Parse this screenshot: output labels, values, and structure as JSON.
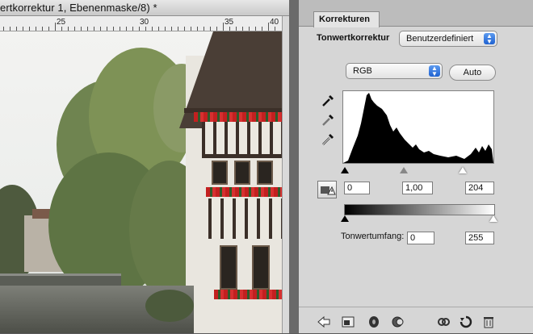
{
  "document": {
    "title": "ertkorrektur 1, Ebenenmaske/8) *",
    "ruler_labels": [
      "25",
      "30",
      "35",
      "40"
    ]
  },
  "panel": {
    "tab_label": "Korrekturen",
    "title": "Tonwertkorrektur",
    "preset_value": "Benutzerdefiniert",
    "channel_value": "RGB",
    "auto_label": "Auto",
    "input_black": "0",
    "input_gamma": "1,00",
    "input_white": "204",
    "output_label": "Tonwertumfang:",
    "output_black": "0",
    "output_white": "255"
  },
  "colors": {
    "accent": "#2a6fdb",
    "panel_bg": "#d6d6d6"
  }
}
